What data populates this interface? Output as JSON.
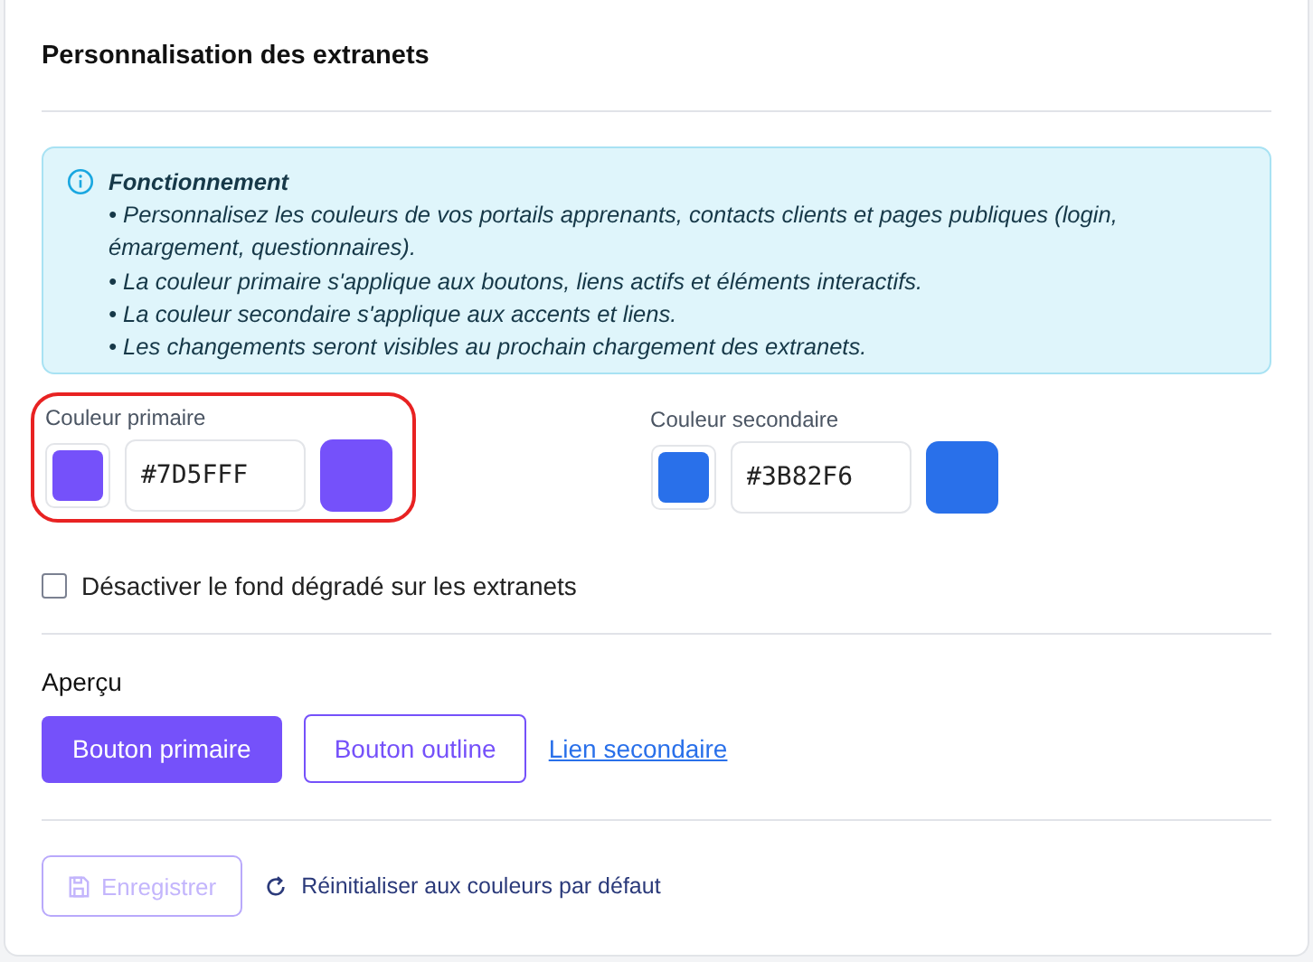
{
  "title": "Personnalisation des extranets",
  "info": {
    "heading": "Fonctionnement",
    "lines": [
      "• Personnalisez les couleurs de vos portails apprenants, contacts clients et pages publiques (login, émargement, questionnaires).",
      "• La couleur primaire s'applique aux boutons, liens actifs et éléments interactifs.",
      "• La couleur secondaire s'applique aux accents et liens.",
      "• Les changements seront visibles au prochain chargement des extranets."
    ]
  },
  "colors": [
    {
      "label": "Couleur primaire",
      "value": "#7D5FFF",
      "color": "#7551fa",
      "highlighted": true
    },
    {
      "label": "Couleur secondaire",
      "value": "#3B82F6",
      "color": "#2970ea",
      "highlighted": false
    }
  ],
  "gradient_option": {
    "label": "Désactiver le fond dégradé sur les extranets",
    "checked": false
  },
  "preview": {
    "heading": "Aperçu",
    "primary_button": "Bouton primaire",
    "outline_button": "Bouton outline",
    "link": "Lien secondaire"
  },
  "footer": {
    "save_button": {
      "label": "Enregistrer",
      "disabled": true
    },
    "reset_link": "Réinitialiser aux couleurs par défaut"
  }
}
